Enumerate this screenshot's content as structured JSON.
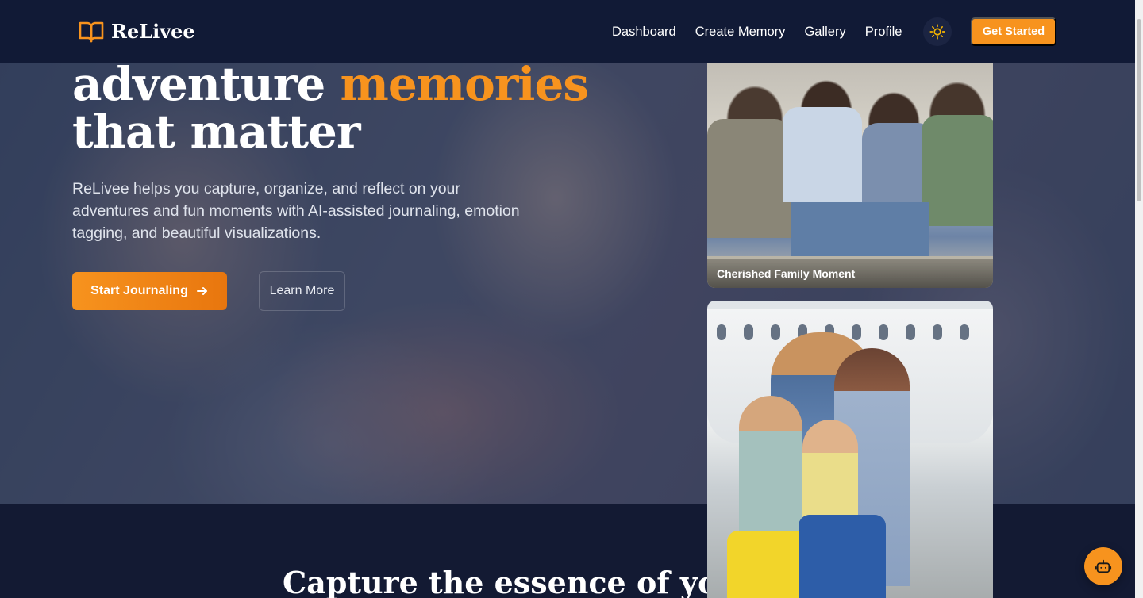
{
  "nav": {
    "brand": "ReLivee",
    "links": [
      "Dashboard",
      "Create Memory",
      "Gallery",
      "Profile"
    ],
    "cta": "Get Started"
  },
  "hero": {
    "headline_line1_a": "adventure ",
    "headline_line1_accent": "memories",
    "headline_line2": "that matter",
    "subtext": "ReLivee helps you capture, organize, and reflect on your adventures and fun moments with AI-assisted journaling, emotion tagging, and beautiful visualizations.",
    "primary_button": "Start Journaling",
    "secondary_button": "Learn More"
  },
  "cards": [
    {
      "caption": "Cherished Family Moment"
    },
    {
      "caption": ""
    }
  ],
  "section": {
    "title": "Capture the essence of your e"
  },
  "colors": {
    "accent": "#f7931e",
    "nav_bg": "#111a36",
    "page_bg": "#131a33"
  },
  "icons": {
    "logo": "book-open-icon",
    "theme": "sun-icon",
    "arrow": "arrow-right-icon",
    "chat": "robot-icon"
  }
}
